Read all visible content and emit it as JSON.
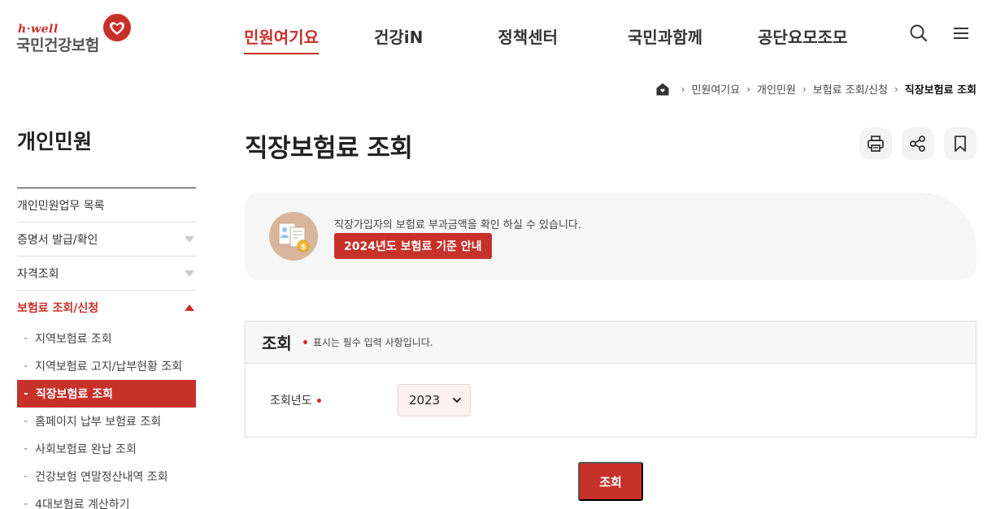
{
  "logo": {
    "tagline": "h·well",
    "name": "국민건강보험"
  },
  "gnb": {
    "items": [
      "민원여기요",
      "건강iN",
      "정책센터",
      "국민과함께",
      "공단요모조모"
    ]
  },
  "breadcrumb": {
    "items": [
      "민원여기요",
      "개인민원",
      "보험료 조회/신청",
      "직장보험료 조회"
    ]
  },
  "sidebar": {
    "title": "개인민원",
    "items": [
      "개인민원업무 목록",
      "증명서 발급/확인",
      "자격조회",
      "보험료 조회/신청"
    ],
    "sub_items": [
      "지역보험료 조회",
      "지역보험료 고지/납부현황 조회",
      "직장보험료 조회",
      "홈페이지 납부 보험료 조회",
      "사회보험료 완납 조회",
      "건강보험 연말정산내역 조회",
      "4대보험료 계산하기"
    ]
  },
  "main": {
    "title": "직장보험료 조회",
    "info_text": "직장가입자의 보험료 부과금액을 확인 하실 수 있습니다.",
    "info_button": "2024년도 보험료 기준 안내",
    "form_title": "조회",
    "required_note": "표시는 필수 입력 사항입니다.",
    "year_label": "조회년도",
    "year_value": "2023",
    "submit_label": "조회"
  },
  "colors": {
    "accent": "#c8302a",
    "info_bg": "#f6f6f6",
    "select_bg": "#fcf1ef"
  }
}
